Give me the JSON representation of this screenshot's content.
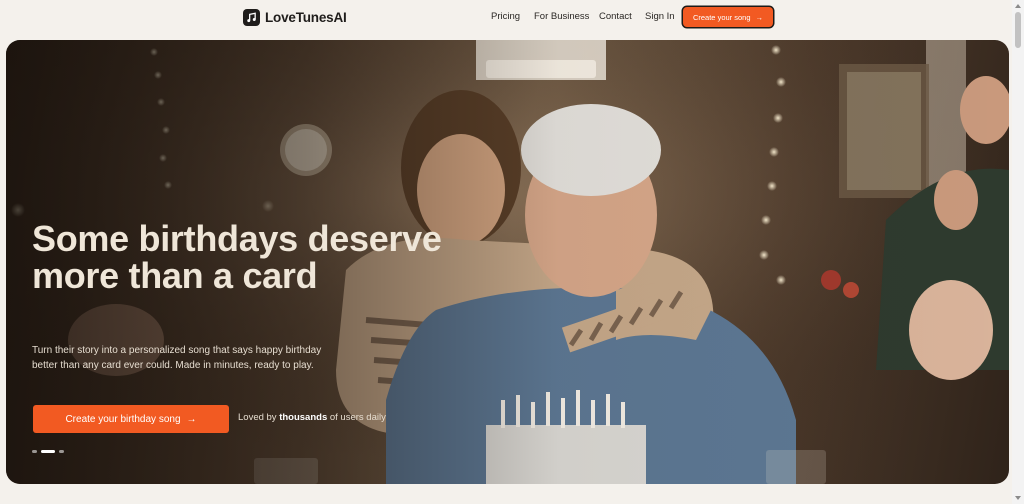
{
  "brand": {
    "name": "LoveTunesAI",
    "logo_icon": "music-note-icon"
  },
  "nav": {
    "links": [
      "Pricing",
      "For Business",
      "Contact",
      "Sign In"
    ],
    "cta_label": "Create your song",
    "cta_arrow": "→"
  },
  "hero": {
    "title": "Some birthdays deserve more than a card",
    "subtitle": "Turn their story into a personalized song that says happy birthday better than any card ever could. Made in minutes, ready to play.",
    "cta_label": "Create your birthday song",
    "cta_arrow": "→",
    "social_proof": {
      "prefix": "Loved by",
      "highlight": "thousands",
      "suffix": "of users daily"
    },
    "carousel": {
      "slides": 3,
      "active_index": 1
    }
  },
  "colors": {
    "accent": "#f25a22",
    "background": "#f4f1ec",
    "text_dark": "#1f1d1b"
  }
}
